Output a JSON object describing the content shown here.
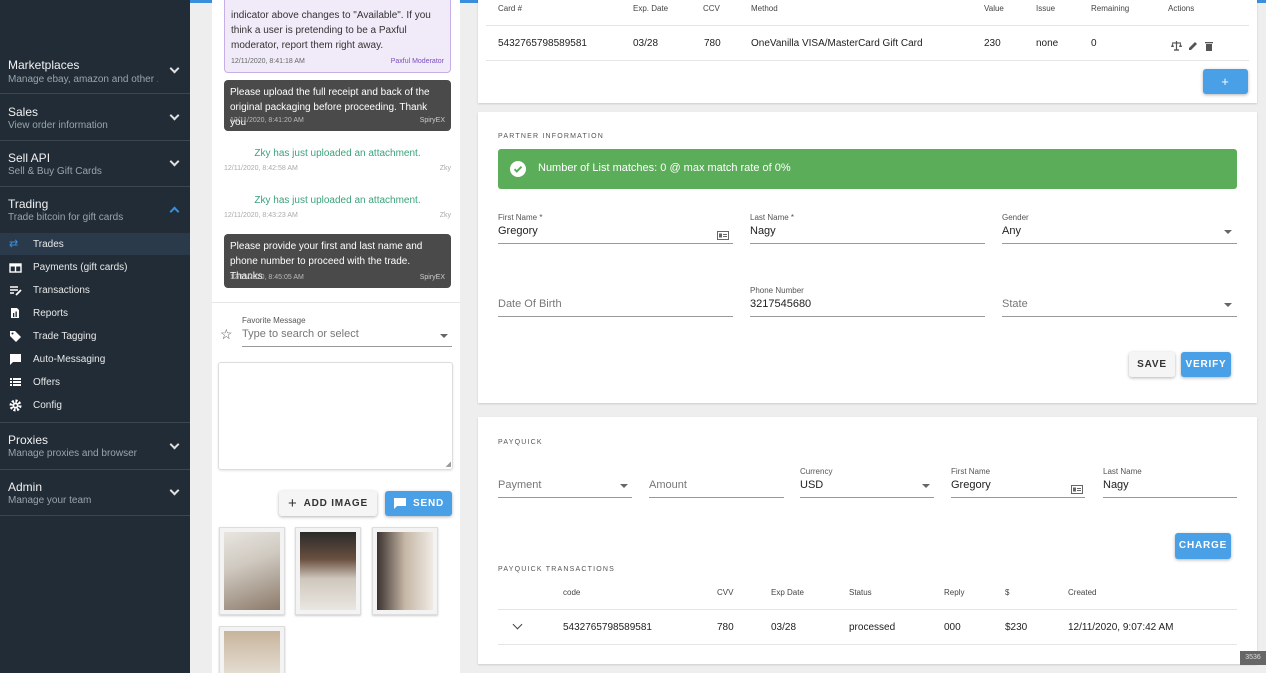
{
  "sidebar": {
    "sections": [
      {
        "title": "Marketplaces",
        "subtitle": "Manage ebay, amazon and other ..."
      },
      {
        "title": "Sales",
        "subtitle": "View order information"
      },
      {
        "title": "Sell API",
        "subtitle": "Sell & Buy Gift Cards"
      },
      {
        "title": "Trading",
        "subtitle": "Trade bitcoin for gift cards"
      },
      {
        "title": "Proxies",
        "subtitle": "Manage proxies and browser"
      },
      {
        "title": "Admin",
        "subtitle": "Manage your team"
      }
    ],
    "trading_items": [
      {
        "label": "Trades",
        "icon": "swap-arrows-icon",
        "active": true
      },
      {
        "label": "Payments (gift cards)",
        "icon": "gift-icon"
      },
      {
        "label": "Transactions",
        "icon": "edit-list-icon"
      },
      {
        "label": "Reports",
        "icon": "report-icon"
      },
      {
        "label": "Trade Tagging",
        "icon": "tag-icon"
      },
      {
        "label": "Auto-Messaging",
        "icon": "message-icon"
      },
      {
        "label": "Offers",
        "icon": "list-icon"
      },
      {
        "label": "Config",
        "icon": "gear-icon"
      }
    ]
  },
  "chat": {
    "mod_message": {
      "text": "indicator above changes to \"Available\". If you think a user is pretending to be a Paxful moderator, report them right away.",
      "time": "12/11/2020, 8:41:18 AM",
      "author": "Paxful Moderator"
    },
    "msg1": {
      "text": "Please upload the full receipt and back of the original packaging before proceeding. Thank you",
      "time": "12/11/2020, 8:41:20 AM",
      "author": "SpiryEX"
    },
    "sys1": {
      "text": "Zky has just uploaded an attachment.",
      "time": "12/11/2020, 8:42:58 AM",
      "author": "Zky"
    },
    "sys2": {
      "text": "Zky has just uploaded an attachment.",
      "time": "12/11/2020, 8:43:23 AM",
      "author": "Zky"
    },
    "msg2": {
      "text": "Please provide your first and last name and phone number to proceed with the trade. Thanks",
      "time": "12/11/2020, 8:45:05 AM",
      "author": "SpiryEX"
    },
    "favorite_label": "Favorite Message",
    "favorite_placeholder": "Type to search or select",
    "add_image": "ADD IMAGE",
    "send": "SEND"
  },
  "cards_table": {
    "headers": [
      "Card #",
      "Exp. Date",
      "CCV",
      "Method",
      "Value",
      "Issue",
      "Remaining",
      "Actions"
    ],
    "row": [
      "5432765798589581",
      "03/28",
      "780",
      "OneVanilla VISA/MasterCard Gift Card",
      "230",
      "none",
      "0"
    ],
    "add_label": "+"
  },
  "partner": {
    "title": "PARTNER INFORMATION",
    "alert": "Number of List matches: 0 @ max match rate of 0%",
    "first_name_label": "First Name *",
    "first_name": "Gregory",
    "last_name_label": "Last Name *",
    "last_name": "Nagy",
    "gender_label": "Gender",
    "gender": "Any",
    "dob_placeholder": "Date Of Birth",
    "phone_label": "Phone Number",
    "phone": "3217545680",
    "state_placeholder": "State",
    "save": "SAVE",
    "verify": "VERIFY"
  },
  "payquick": {
    "title": "PAYQUICK",
    "payment_placeholder": "Payment",
    "amount_placeholder": "Amount",
    "currency_label": "Currency",
    "currency": "USD",
    "first_name_label": "First Name",
    "first_name": "Gregory",
    "last_name_label": "Last Name",
    "last_name": "Nagy",
    "charge": "CHARGE",
    "tx_title": "PAYQUICK TRANSACTIONS",
    "tx_headers": [
      "code",
      "CVV",
      "Exp Date",
      "Status",
      "Reply",
      "$",
      "Created"
    ],
    "tx_row": [
      "5432765798589581",
      "780",
      "03/28",
      "processed",
      "000",
      "$230",
      "12/11/2020, 9:07:42 AM"
    ]
  },
  "corner_badge": "3536",
  "colors": {
    "accent": "#4aa0e6",
    "alert_green": "#5cad5a",
    "sidebar_bg": "#212c36"
  }
}
